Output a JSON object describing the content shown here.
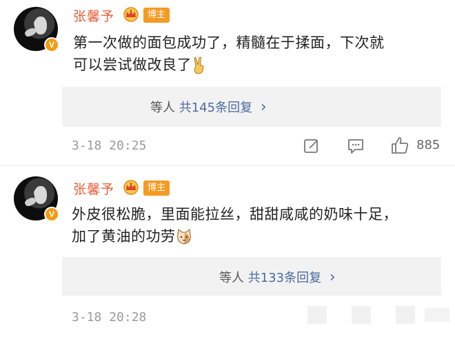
{
  "comments": [
    {
      "author": "张馨予",
      "badge": "博主",
      "text_line1": "第一次做的面包成功了，精髓在于揉面，下次就",
      "text_line2": "可以尝试做改良了",
      "text_emoji": "victory-hand",
      "reply_prefix": "等人",
      "reply_link": "共145条回复",
      "reply_chevron": "›",
      "time": "3-18 20:25",
      "likes": "885"
    },
    {
      "author": "张馨予",
      "badge": "博主",
      "text_line1": "外皮很松脆，里面能拉丝，甜甜咸咸的奶味十足，",
      "text_line2": "加了黄油的功劳",
      "text_emoji": "cat-face",
      "reply_prefix": "等人",
      "reply_link": "共133条回复",
      "reply_chevron": "›",
      "time": "3-18 20:28",
      "likes": ""
    }
  ],
  "colors": {
    "author": "#e8603c",
    "badge_bg": "#f59a23",
    "reply_link": "#4a6aa0",
    "reply_bg": "#f2f2f2",
    "muted": "#9a9a9a"
  },
  "icons": [
    "avatar",
    "verified-badge-icon",
    "crown-icon",
    "share-icon",
    "comment-icon",
    "like-icon"
  ]
}
